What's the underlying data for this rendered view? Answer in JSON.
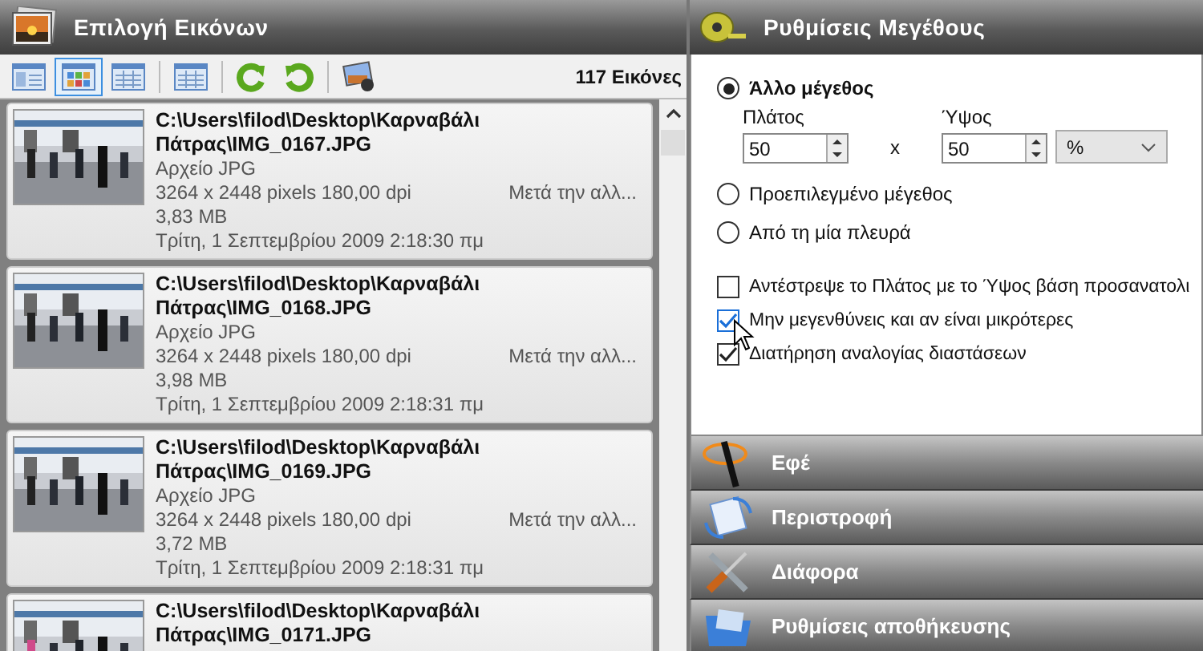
{
  "left_panel": {
    "title": "Επιλογή Εικόνων",
    "toolbar": [
      {
        "kind": "view-details",
        "selected": false
      },
      {
        "kind": "view-thumbs",
        "selected": true
      },
      {
        "kind": "view-list",
        "selected": false
      },
      {
        "kind": "separator"
      },
      {
        "kind": "view-table",
        "selected": false
      },
      {
        "kind": "separator"
      },
      {
        "kind": "rotate-left"
      },
      {
        "kind": "rotate-right"
      },
      {
        "kind": "separator"
      },
      {
        "kind": "preview"
      }
    ],
    "count": "117 Εικόνες",
    "images": [
      {
        "path": "C:\\Users\\filod\\Desktop\\Καρναβάλι Πάτρας\\IMG_0167.JPG",
        "type": "Αρχείο JPG",
        "dimensions": "3264 x 2448 pixels 180,00 dpi",
        "status": "Μετά την αλλ...",
        "size": "3,83 MB",
        "date": "Τρίτη, 1 Σεπτεμβρίου 2009 2:18:30 πμ"
      },
      {
        "path": "C:\\Users\\filod\\Desktop\\Καρναβάλι Πάτρας\\IMG_0168.JPG",
        "type": "Αρχείο JPG",
        "dimensions": "3264 x 2448 pixels 180,00 dpi",
        "status": "Μετά την αλλ...",
        "size": "3,98 MB",
        "date": "Τρίτη, 1 Σεπτεμβρίου 2009 2:18:31 πμ"
      },
      {
        "path": "C:\\Users\\filod\\Desktop\\Καρναβάλι Πάτρας\\IMG_0169.JPG",
        "type": "Αρχείο JPG",
        "dimensions": "3264 x 2448 pixels 180,00 dpi",
        "status": "Μετά την αλλ...",
        "size": "3,72 MB",
        "date": "Τρίτη, 1 Σεπτεμβρίου 2009 2:18:31 πμ"
      },
      {
        "path": "C:\\Users\\filod\\Desktop\\Καρναβάλι Πάτρας\\IMG_0171.JPG"
      }
    ]
  },
  "size_settings": {
    "title": "Ρυθμίσεις Μεγέθους",
    "modes": [
      {
        "label": "Άλλο μέγεθος",
        "selected": true
      },
      {
        "label": "Προεπιλεγμένο μέγεθος",
        "selected": false
      },
      {
        "label": "Από τη μία πλευρά",
        "selected": false
      }
    ],
    "width_label": "Πλάτος",
    "width_value": "50",
    "times": "x",
    "height_label": "Ύψος",
    "height_value": "50",
    "unit": "%",
    "options": [
      {
        "label": "Αντέστρεψε το Πλάτος με το Ύψος βάση προσανατολι",
        "checked": false
      },
      {
        "label": "Μην μεγενθύνεις και αν είναι μικρότερες",
        "checked": true
      },
      {
        "label": "Διατήρηση αναλογίας διαστάσεων",
        "checked": true
      }
    ]
  },
  "sections": [
    {
      "title": "Εφέ",
      "kind": "effects"
    },
    {
      "title": "Περιστροφή",
      "kind": "rotation"
    },
    {
      "title": "Διάφορα",
      "kind": "misc"
    },
    {
      "title": "Ρυθμίσεις αποθήκευσης",
      "kind": "save"
    }
  ]
}
